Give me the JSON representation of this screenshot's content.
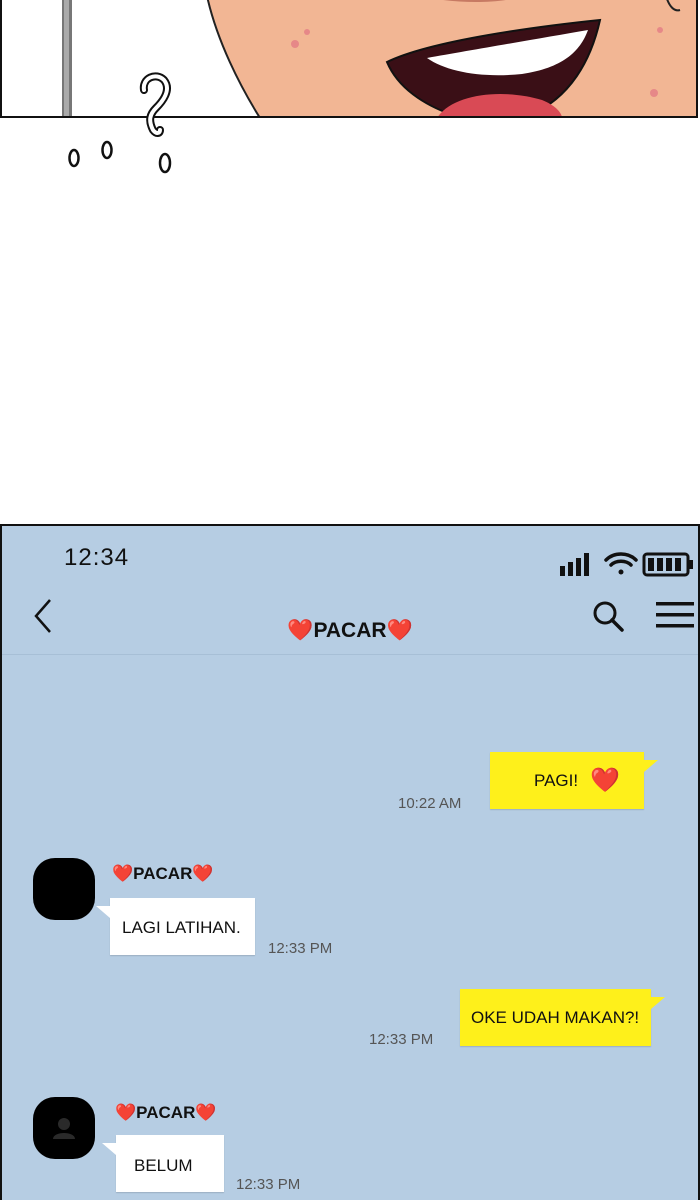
{
  "comic": {
    "sfx_mark": "?",
    "sfx_dots": [
      "O",
      "O",
      "O"
    ]
  },
  "status_bar": {
    "time": "12:34",
    "icons": [
      "signal-icon",
      "wifi-icon",
      "battery-icon"
    ]
  },
  "header": {
    "title": "PACAR",
    "title_emoji": "❤️",
    "back_icon": "chevron-left-icon",
    "search_icon": "search-icon",
    "menu_icon": "hamburger-menu-icon"
  },
  "colors": {
    "chat_bg": "#b6cde3",
    "my_bubble": "#fef01b",
    "their_bubble": "#ffffff",
    "heart": "#e0262d"
  },
  "messages": [
    {
      "from": "me",
      "text": "PAGI!",
      "emoji": "❤️",
      "time": "10:22 AM"
    },
    {
      "from": "them",
      "sender": "PACAR",
      "text": "LAGI LATIHAN.",
      "time": "12:33 PM"
    },
    {
      "from": "me",
      "text": "OKE UDAH MAKAN?!",
      "time": "12:33 PM"
    },
    {
      "from": "them",
      "sender": "PACAR",
      "text": "BELUM",
      "time": "12:33 PM"
    }
  ]
}
